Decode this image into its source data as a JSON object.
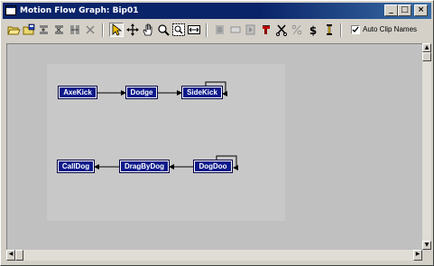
{
  "window": {
    "title": "Motion Flow Graph: Bip01",
    "minimize_glyph": "_",
    "maximize_glyph": "□",
    "close_glyph": "×"
  },
  "toolbar": {
    "tools": [
      "open-file-icon",
      "save-file-icon",
      "add-transition-icon",
      "edit-transition-icon",
      "delete-transition-icon",
      "delete-icon",
      "select-arrow-icon",
      "move-icon",
      "pan-hand-icon",
      "zoom-icon",
      "zoom-region-icon",
      "zoom-extents-icon",
      "create-script-icon",
      "clear-icon",
      "run-icon",
      "random-icon",
      "cut-icon",
      "percent-icon",
      "dollar-icon",
      "clip-icon"
    ],
    "auto_clip_names": {
      "label": "Auto Clip Names",
      "checked": true
    }
  },
  "graph": {
    "nodes": [
      {
        "id": "axekick",
        "label": "AxeKick"
      },
      {
        "id": "dodge",
        "label": "Dodge"
      },
      {
        "id": "sidekick",
        "label": "SideKick"
      },
      {
        "id": "calldog",
        "label": "CallDog"
      },
      {
        "id": "dragbydog",
        "label": "DragByDog"
      },
      {
        "id": "dogdoo",
        "label": "DogDoo"
      }
    ],
    "transitions": [
      {
        "from": "AxeKick",
        "to": "Dodge"
      },
      {
        "from": "Dodge",
        "to": "SideKick"
      },
      {
        "from": "SideKick",
        "to": "SideKick"
      },
      {
        "from": "DogDoo",
        "to": "DragByDog"
      },
      {
        "from": "DragByDog",
        "to": "CallDog"
      },
      {
        "from": "DogDoo",
        "to": "DogDoo"
      }
    ]
  },
  "colors": {
    "node_fill": "#0c1a8a",
    "node_text": "#ffffff",
    "canvas": "#c0c0c0",
    "titlebar": "#0a246a"
  }
}
